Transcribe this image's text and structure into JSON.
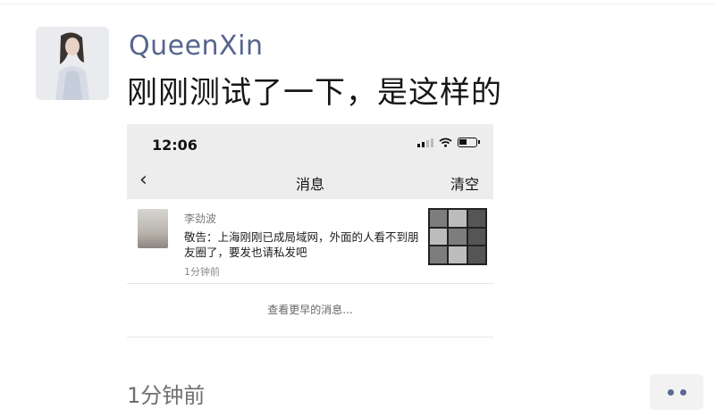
{
  "post": {
    "author": "QueenXin",
    "text": "刚刚测试了一下，是这样的",
    "time": "1分钟前"
  },
  "screenshot": {
    "status_time": "12:06",
    "nav": {
      "back_icon": "‹",
      "title": "消息",
      "clear_label": "清空"
    },
    "message": {
      "sender": "李劲波",
      "text": "敬告：上海刚刚已成局域网，外面的人看不到朋友圈了，要发也请私发吧",
      "time": "1分钟前"
    },
    "earlier_label": "查看更早的消息..."
  },
  "icons": [
    "avatar",
    "signal-icon",
    "wifi-icon",
    "battery-icon",
    "back-icon",
    "more-icon"
  ],
  "colors": {
    "author": "#56648f",
    "header_bg": "#ededed"
  }
}
